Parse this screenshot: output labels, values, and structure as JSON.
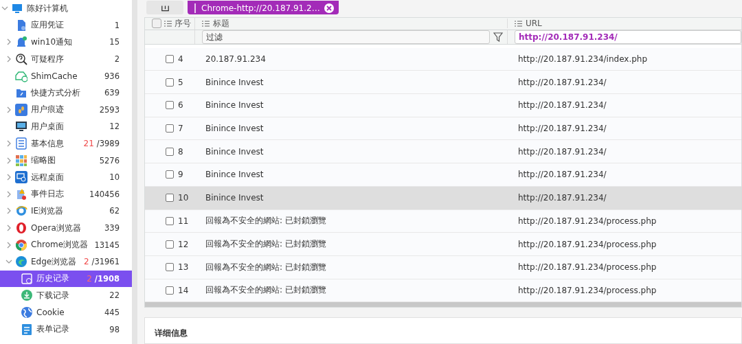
{
  "sidebar": {
    "tree": [
      {
        "label": "陈好计算机",
        "expanded": true,
        "children": [
          {
            "label": "应用凭证",
            "count": "1"
          },
          {
            "label": "win10通知",
            "count": "15",
            "expanded": false
          },
          {
            "label": "可疑程序",
            "count": "2",
            "expanded": false
          },
          {
            "label": "ShimCache",
            "count": "936"
          },
          {
            "label": "快捷方式分析",
            "count": "639"
          },
          {
            "label": "用户痕迹",
            "count": "2593",
            "expanded": false
          },
          {
            "label": "用户桌面",
            "count": "12"
          },
          {
            "label": "基本信息",
            "new_count": "21",
            "count": "/3989",
            "expanded": false
          },
          {
            "label": "缩略图",
            "count": "5276",
            "expanded": false
          },
          {
            "label": "远程桌面",
            "count": "10",
            "expanded": false
          },
          {
            "label": "事件日志",
            "count": "140456",
            "expanded": false
          },
          {
            "label": "IE浏览器",
            "count": "62",
            "expanded": false
          },
          {
            "label": "Opera浏览器",
            "count": "339",
            "expanded": false
          },
          {
            "label": "Chrome浏览器",
            "count": "13145",
            "expanded": false
          },
          {
            "label": "Edge浏览器",
            "new_count": "2",
            "count": "/31961",
            "expanded": true,
            "children": [
              {
                "label": "历史记录",
                "new_count": "2",
                "count": "/1908",
                "selected": true
              },
              {
                "label": "下载记录",
                "count": "22",
                "selected": false
              },
              {
                "label": "Cookie",
                "count": "445",
                "selected": false
              },
              {
                "label": "表单记录",
                "count": "98",
                "selected": false
              }
            ]
          }
        ]
      }
    ]
  },
  "filter_tag": {
    "label": "Chrome-http://20.187.91.2…"
  },
  "table": {
    "all_checked": false,
    "columns": [
      "序号",
      "标题",
      "URL"
    ],
    "filters": [
      {
        "placeholder": "过滤"
      },
      {
        "value": "http://20.187.91.234/"
      }
    ],
    "rows": [
      {
        "number": "4",
        "title": "20.187.91.234",
        "url": "http://20.187.91.234/index.php",
        "checked": false,
        "selected": false
      },
      {
        "number": "5",
        "title": "Binince Invest",
        "url": "http://20.187.91.234/",
        "checked": false,
        "selected": false
      },
      {
        "number": "6",
        "title": "Binince Invest",
        "url": "http://20.187.91.234/",
        "checked": false,
        "selected": false
      },
      {
        "number": "7",
        "title": "Binince Invest",
        "url": "http://20.187.91.234/",
        "checked": false,
        "selected": false
      },
      {
        "number": "8",
        "title": "Binince Invest",
        "url": "http://20.187.91.234/",
        "checked": false,
        "selected": false
      },
      {
        "number": "9",
        "title": "Binince Invest",
        "url": "http://20.187.91.234/",
        "checked": false,
        "selected": false
      },
      {
        "number": "10",
        "title": "Binince Invest",
        "url": "http://20.187.91.234/",
        "checked": false,
        "selected": true
      },
      {
        "number": "11",
        "title": "回報為不安全的網站: 已封鎖瀏覽",
        "url": "http://20.187.91.234/process.php",
        "checked": false,
        "selected": false
      },
      {
        "number": "12",
        "title": "回報為不安全的網站: 已封鎖瀏覽",
        "url": "http://20.187.91.234/process.php",
        "checked": false,
        "selected": false
      },
      {
        "number": "13",
        "title": "回報為不安全的網站: 已封鎖瀏覽",
        "url": "http://20.187.91.234/process.php",
        "checked": false,
        "selected": false
      },
      {
        "number": "14",
        "title": "回報為不安全的網站: 已封鎖瀏覽",
        "url": "http://20.187.91.234/process.php",
        "checked": false,
        "selected": false
      }
    ]
  },
  "details_panel": {
    "title": "详细信息"
  }
}
